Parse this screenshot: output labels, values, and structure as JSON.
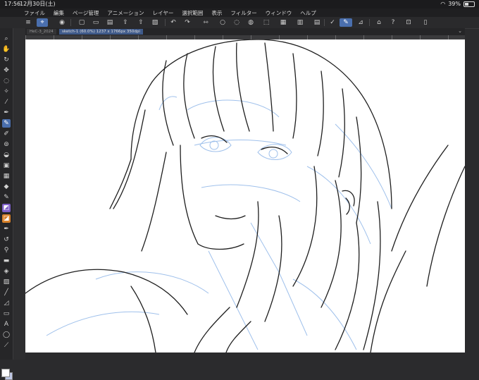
{
  "status": {
    "time": "17:56",
    "date": "12月30日(土)",
    "battery_text": "39%",
    "battery_level": 0.39
  },
  "menu": [
    "ファイル",
    "編集",
    "ページ管理",
    "アニメーション",
    "レイヤー",
    "選択範囲",
    "表示",
    "フィルター",
    "ウィンドウ",
    "ヘルプ"
  ],
  "tabs": [
    {
      "label": "HeC-3_2024"
    },
    {
      "label": "sketch-1 (60.0%) 1237 x 1766px 350dpi"
    }
  ],
  "colors": {
    "accent": "#4a6fae",
    "sketch_blue": "#8fb6e8",
    "line": "#1e1e1e",
    "main_color": "#ffffff",
    "sub_color": "#bfc8e6"
  }
}
